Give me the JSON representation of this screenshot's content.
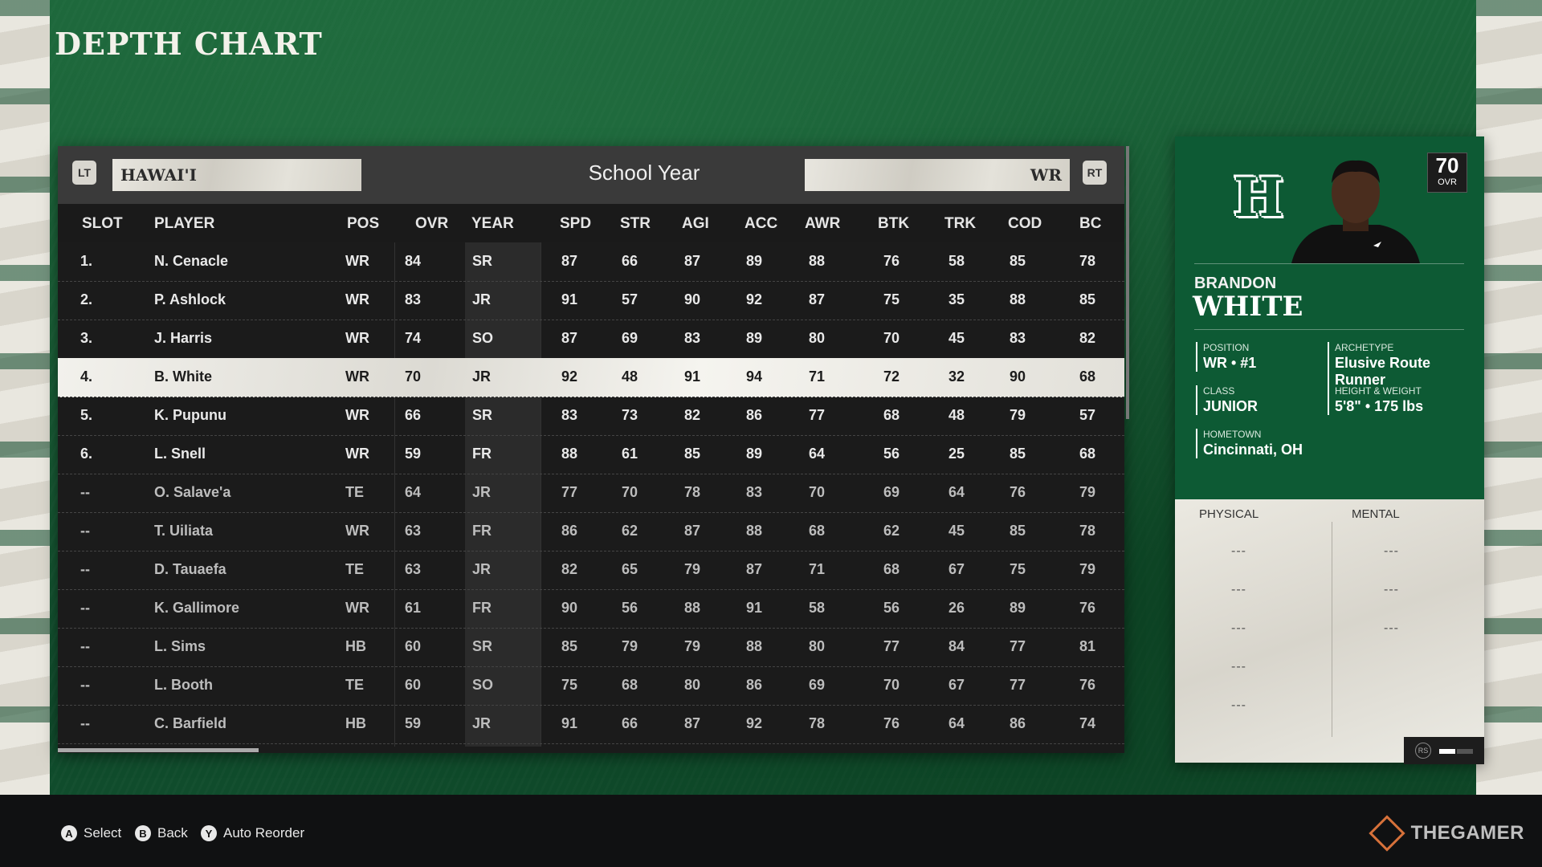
{
  "page_title": "DEPTH CHART",
  "header": {
    "lt_button": "LT",
    "rt_button": "RT",
    "team": "HAWAI'I",
    "sort_label": "School Year",
    "position_filter": "WR"
  },
  "columns": [
    "SLOT",
    "PLAYER",
    "POS",
    "OVR",
    "YEAR",
    "SPD",
    "STR",
    "AGI",
    "ACC",
    "AWR",
    "BTK",
    "TRK",
    "COD",
    "BC"
  ],
  "rows": [
    {
      "slot": "1.",
      "player": "N. Cenacle",
      "pos": "WR",
      "ovr": "84",
      "year": "SR",
      "spd": "87",
      "str": "66",
      "agi": "87",
      "acc": "89",
      "awr": "88",
      "btk": "76",
      "trk": "58",
      "cod": "85",
      "bc": "78"
    },
    {
      "slot": "2.",
      "player": "P. Ashlock",
      "pos": "WR",
      "ovr": "83",
      "year": "JR",
      "spd": "91",
      "str": "57",
      "agi": "90",
      "acc": "92",
      "awr": "87",
      "btk": "75",
      "trk": "35",
      "cod": "88",
      "bc": "85"
    },
    {
      "slot": "3.",
      "player": "J. Harris",
      "pos": "WR",
      "ovr": "74",
      "year": "SO",
      "spd": "87",
      "str": "69",
      "agi": "83",
      "acc": "89",
      "awr": "80",
      "btk": "70",
      "trk": "45",
      "cod": "83",
      "bc": "82"
    },
    {
      "slot": "4.",
      "player": "B. White",
      "pos": "WR",
      "ovr": "70",
      "year": "JR",
      "spd": "92",
      "str": "48",
      "agi": "91",
      "acc": "94",
      "awr": "71",
      "btk": "72",
      "trk": "32",
      "cod": "90",
      "bc": "68"
    },
    {
      "slot": "5.",
      "player": "K. Pupunu",
      "pos": "WR",
      "ovr": "66",
      "year": "SR",
      "spd": "83",
      "str": "73",
      "agi": "82",
      "acc": "86",
      "awr": "77",
      "btk": "68",
      "trk": "48",
      "cod": "79",
      "bc": "57"
    },
    {
      "slot": "6.",
      "player": "L. Snell",
      "pos": "WR",
      "ovr": "59",
      "year": "FR",
      "spd": "88",
      "str": "61",
      "agi": "85",
      "acc": "89",
      "awr": "64",
      "btk": "56",
      "trk": "25",
      "cod": "85",
      "bc": "68"
    },
    {
      "slot": "--",
      "player": "O. Salave'a",
      "pos": "TE",
      "ovr": "64",
      "year": "JR",
      "spd": "77",
      "str": "70",
      "agi": "78",
      "acc": "83",
      "awr": "70",
      "btk": "69",
      "trk": "64",
      "cod": "76",
      "bc": "79"
    },
    {
      "slot": "--",
      "player": "T. Uiliata",
      "pos": "WR",
      "ovr": "63",
      "year": "FR",
      "spd": "86",
      "str": "62",
      "agi": "87",
      "acc": "88",
      "awr": "68",
      "btk": "62",
      "trk": "45",
      "cod": "85",
      "bc": "78"
    },
    {
      "slot": "--",
      "player": "D. Tauaefa",
      "pos": "TE",
      "ovr": "63",
      "year": "JR",
      "spd": "82",
      "str": "65",
      "agi": "79",
      "acc": "87",
      "awr": "71",
      "btk": "68",
      "trk": "67",
      "cod": "75",
      "bc": "79"
    },
    {
      "slot": "--",
      "player": "K. Gallimore",
      "pos": "WR",
      "ovr": "61",
      "year": "FR",
      "spd": "90",
      "str": "56",
      "agi": "88",
      "acc": "91",
      "awr": "58",
      "btk": "56",
      "trk": "26",
      "cod": "89",
      "bc": "76"
    },
    {
      "slot": "--",
      "player": "L. Sims",
      "pos": "HB",
      "ovr": "60",
      "year": "SR",
      "spd": "85",
      "str": "79",
      "agi": "79",
      "acc": "88",
      "awr": "80",
      "btk": "77",
      "trk": "84",
      "cod": "77",
      "bc": "81"
    },
    {
      "slot": "--",
      "player": "L. Booth",
      "pos": "TE",
      "ovr": "60",
      "year": "SO",
      "spd": "75",
      "str": "68",
      "agi": "80",
      "acc": "86",
      "awr": "69",
      "btk": "70",
      "trk": "67",
      "cod": "77",
      "bc": "76"
    },
    {
      "slot": "--",
      "player": "C. Barfield",
      "pos": "HB",
      "ovr": "59",
      "year": "JR",
      "spd": "91",
      "str": "66",
      "agi": "87",
      "acc": "92",
      "awr": "78",
      "btk": "76",
      "trk": "64",
      "cod": "86",
      "bc": "74"
    }
  ],
  "selected_index": 3,
  "player_card": {
    "first_name": "BRANDON",
    "last_name": "WHITE",
    "ovr": "70",
    "ovr_label": "OVR",
    "position_label": "POSITION",
    "position_value": "WR • #1",
    "archetype_label": "ARCHETYPE",
    "archetype_value": "Elusive Route Runner",
    "class_label": "CLASS",
    "class_value": "JUNIOR",
    "hw_label": "HEIGHT & WEIGHT",
    "hw_value": "5'8\" • 175 lbs",
    "hometown_label": "HOMETOWN",
    "hometown_value": "Cincinnati, OH",
    "physical_label": "PHYSICAL",
    "mental_label": "MENTAL",
    "physical_values": [
      "---",
      "---",
      "---",
      "---",
      "---"
    ],
    "mental_values": [
      "---",
      "---",
      "---"
    ],
    "toggle_label": "RS"
  },
  "controls": [
    {
      "button": "A",
      "label": "Select"
    },
    {
      "button": "B",
      "label": "Back"
    },
    {
      "button": "Y",
      "label": "Auto Reorder"
    }
  ],
  "watermark": "THEGAMER",
  "colors": {
    "accent_green": "#0d5a34",
    "selected_row": "#efeee8",
    "panel": "#1b1b1b"
  }
}
